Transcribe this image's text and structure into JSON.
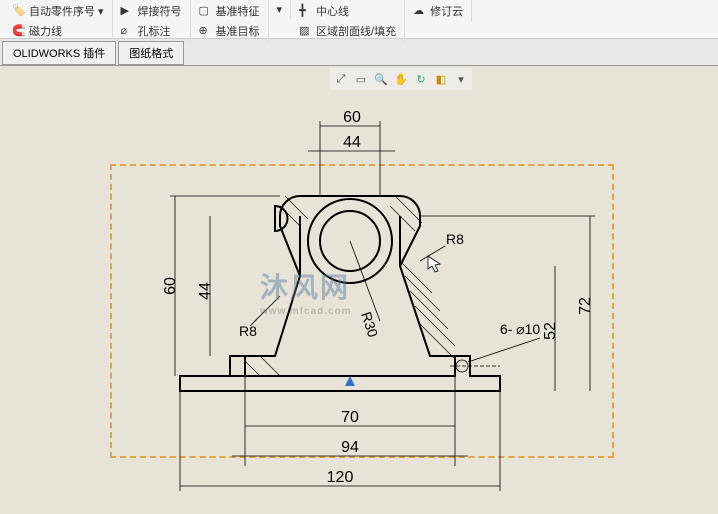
{
  "ribbon": {
    "groups": [
      {
        "items": [
          {
            "label": "自动零件序号",
            "icon": "tag-icon"
          },
          {
            "label": "磁力线",
            "icon": "magnet-icon"
          }
        ]
      },
      {
        "items": [
          {
            "label": "焊接符号",
            "icon": "weld-icon"
          },
          {
            "label": "孔标注",
            "icon": "hole-icon"
          }
        ]
      },
      {
        "items": [
          {
            "label": "基准特征",
            "icon": "datum-icon"
          },
          {
            "label": "基准目标",
            "icon": "target-icon"
          }
        ]
      },
      {
        "items": [
          {
            "label": "",
            "icon": "dropdown-icon"
          }
        ]
      },
      {
        "items": [
          {
            "label": "中心线",
            "icon": "centerline-icon"
          },
          {
            "label": "区域剖面线/填充",
            "icon": "hatch-icon"
          }
        ]
      },
      {
        "items": [
          {
            "label": "修订云",
            "icon": "cloud-icon"
          }
        ]
      }
    ]
  },
  "tabs": [
    {
      "label": "OLIDWORKS 插件"
    },
    {
      "label": "图纸格式"
    }
  ],
  "dimensions": {
    "top1": "60",
    "top2": "44",
    "left1": "60",
    "left2": "44",
    "r8a": "R8",
    "r8b": "R8",
    "r30": "R30",
    "hole": "6- ⌀10",
    "right1": "72",
    "right2": "52",
    "bot1": "70",
    "bot2": "94",
    "bot3": "120"
  },
  "watermark": {
    "main": "沐风网",
    "sub": "www.mfcad.com"
  }
}
